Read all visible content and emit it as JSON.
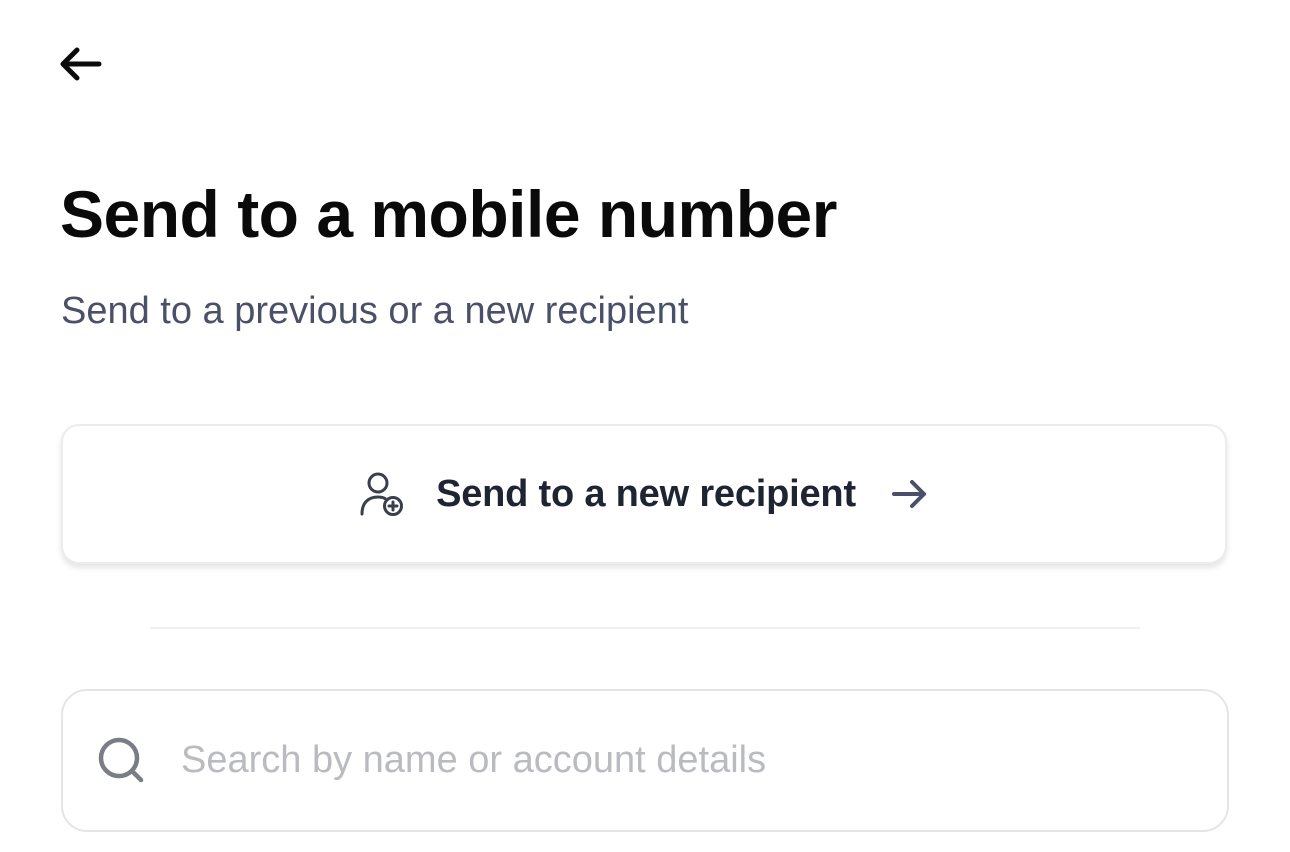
{
  "header": {
    "back_icon": "arrow-left-icon"
  },
  "title": "Send to a mobile number",
  "subtitle": "Send to a previous or a new recipient",
  "new_recipient": {
    "icon": "person-add-icon",
    "label": "Send to a new recipient",
    "arrow_icon": "arrow-right-icon"
  },
  "search": {
    "icon": "search-icon",
    "placeholder": "Search by name or account details",
    "value": ""
  },
  "colors": {
    "title": "#0a0a0b",
    "subtitle": "#4a5068",
    "card_label": "#1f2433",
    "placeholder": "#b9bbc1",
    "border": "#e4e5e9"
  }
}
